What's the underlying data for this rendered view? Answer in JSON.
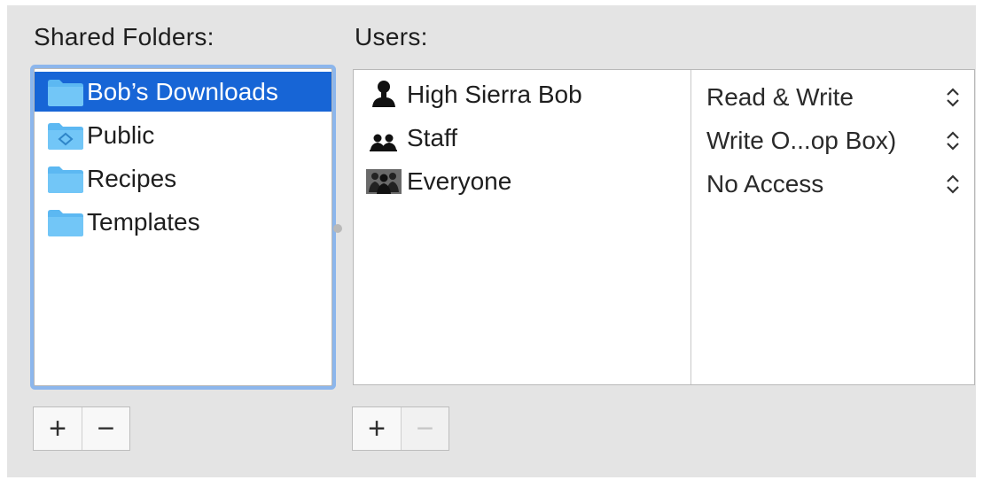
{
  "shared_folders": {
    "label": "Shared Folders:",
    "items": [
      {
        "name": "Bob’s Downloads",
        "icon": "folder-icon",
        "selected": true
      },
      {
        "name": "Public",
        "icon": "public-folder-icon",
        "selected": false
      },
      {
        "name": "Recipes",
        "icon": "folder-icon",
        "selected": false
      },
      {
        "name": "Templates",
        "icon": "folder-icon",
        "selected": false
      }
    ],
    "add_label": "+",
    "remove_label": "−"
  },
  "users": {
    "label": "Users:",
    "rows": [
      {
        "name": "High Sierra Bob",
        "icon": "single-user-icon",
        "permission": "Read & Write"
      },
      {
        "name": "Staff",
        "icon": "group-icon",
        "permission": "Write O...op Box)"
      },
      {
        "name": "Everyone",
        "icon": "everyone-icon",
        "permission": "No Access"
      }
    ],
    "add_label": "+",
    "remove_label": "−",
    "remove_enabled": false
  },
  "colors": {
    "selection": "#1765d6",
    "focus_ring": "#8cb6ec",
    "folder_blue": "#5cb8f2",
    "panel_bg": "#e4e4e4"
  }
}
